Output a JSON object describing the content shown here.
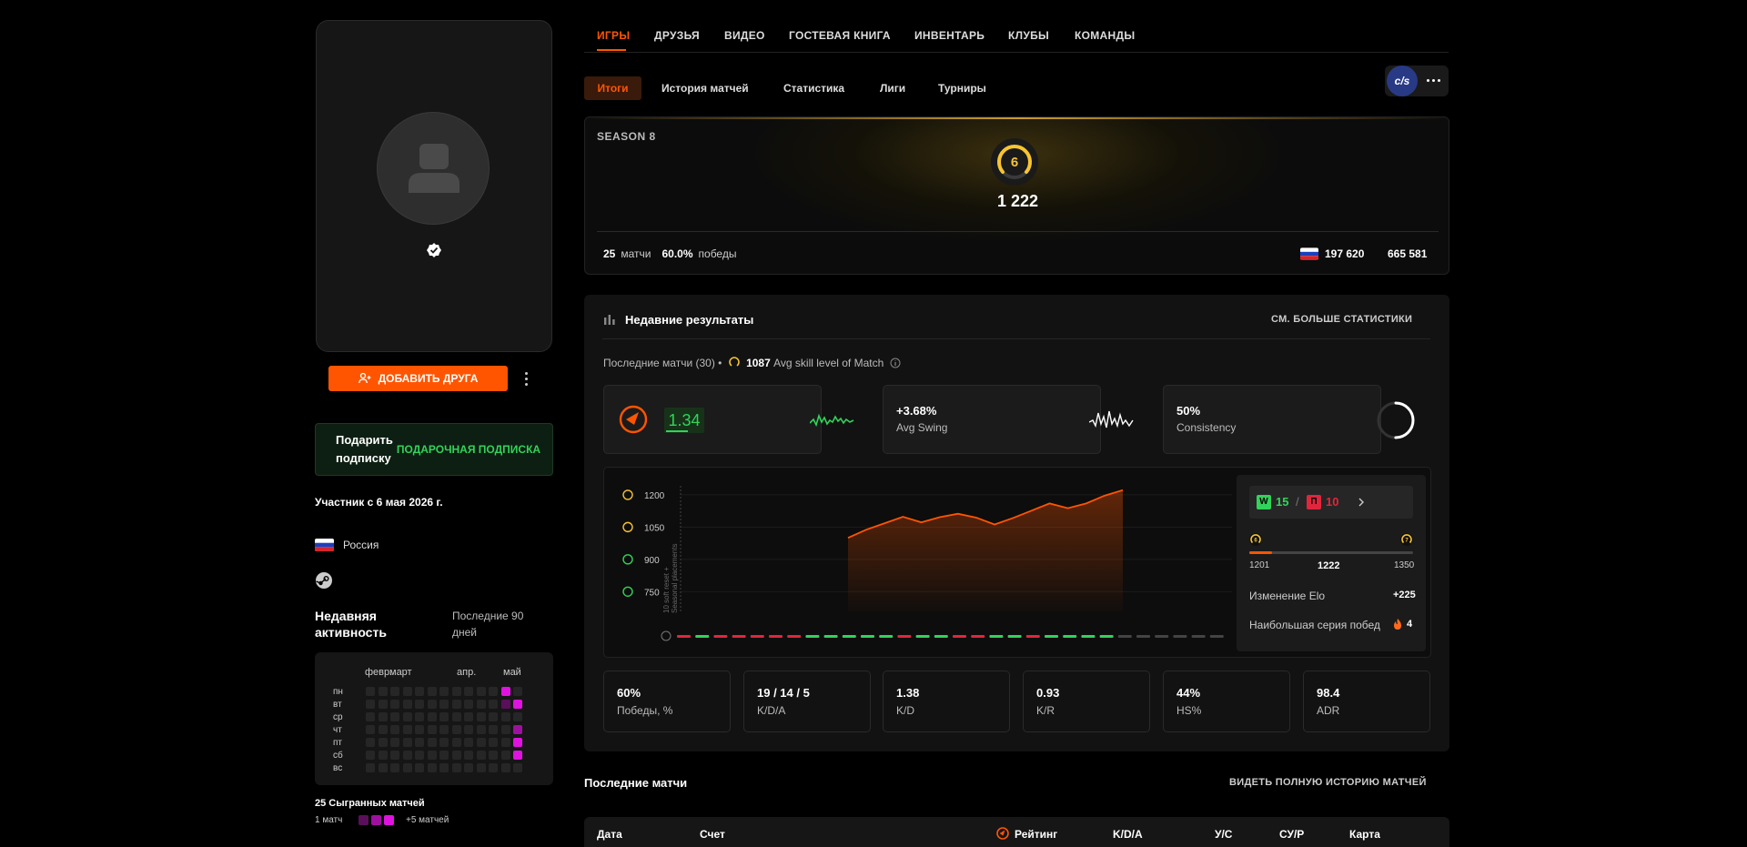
{
  "profile": {
    "add_friend_label": "ДОБАВИТЬ ДРУГА",
    "gift_text": "Подарить подписку",
    "gift_link": "ПОДАРОЧНАЯ ПОДПИСКА",
    "member_since": "Участник с 6 мая 2026 г.",
    "country": "Россия",
    "activity_title": "Недавняя активность",
    "activity_period": "Последние 90 дней",
    "months": [
      "февр.",
      "март",
      "апр.",
      "май"
    ],
    "days": [
      "пн",
      "вт",
      "ср",
      "чт",
      "пт",
      "сб",
      "вс"
    ],
    "games_played": "25 Сыгранных матчей",
    "legend_min": "1 матч",
    "legend_max": "+5 матчей",
    "colors": {
      "accent": "#ff5500",
      "gift_green": "#32d35a",
      "heat_high": "#e012e0",
      "heat_low": "#5a0f5a"
    }
  },
  "tabs": [
    {
      "label": "ИГРЫ"
    },
    {
      "label": "ДРУЗЬЯ"
    },
    {
      "label": "ВИДЕО"
    },
    {
      "label": "ГОСТЕВАЯ КНИГА"
    },
    {
      "label": "ИНВЕНТАРЬ"
    },
    {
      "label": "КЛУБЫ"
    },
    {
      "label": "КОМАНДЫ"
    }
  ],
  "subtabs": [
    {
      "label": "Итоги"
    },
    {
      "label": "История матчей"
    },
    {
      "label": "Статистика"
    },
    {
      "label": "Лиги"
    },
    {
      "label": "Турниры"
    }
  ],
  "game_logo": "c/s",
  "season": {
    "label": "SEASON 8",
    "level": "6",
    "elo": "1 222",
    "matches_value": "25",
    "matches_label": "матчи",
    "winrate_value": "60.0%",
    "winrate_label": "победы",
    "rank_country": "197 620",
    "rank_global": "665 581"
  },
  "recent": {
    "title": "Недавние результаты",
    "see_more": "СМ. БОЛЬШЕ СТАТИСТИКИ",
    "last_matches": "Последние матчи (30) •",
    "avg_skill_value": "1087",
    "avg_skill_label": "Avg skill level of Match",
    "rating_value": "1.34",
    "swing_value": "+3.68%",
    "swing_label": "Avg Swing",
    "consistency_value": "50%",
    "consistency_label": "Consistency",
    "consistency_fraction": 0.5
  },
  "chart_data": {
    "type": "area",
    "y_ticks": [
      "1200",
      "1050",
      "900",
      "750"
    ],
    "ylim": [
      675,
      1225
    ],
    "placement_label": "Seasonal placements",
    "placement_sublabel": "10 soft reset +",
    "elo": [
      1000,
      1038,
      1068,
      1098,
      1072,
      1096,
      1112,
      1094,
      1062,
      1092,
      1126,
      1160,
      1138,
      1160,
      1196,
      1222
    ],
    "results": [
      "L",
      "W",
      "L",
      "L",
      "L",
      "L",
      "L",
      "W",
      "W",
      "W",
      "W",
      "W",
      "L",
      "W",
      "W",
      "L",
      "L",
      "W",
      "W",
      "L",
      "W",
      "W",
      "W",
      "W",
      "N",
      "N",
      "N",
      "N",
      "N",
      "N"
    ],
    "colors": {
      "win": "#32d35a",
      "loss": "#e0263c",
      "none": "#444444",
      "line": "#ff5500"
    }
  },
  "side": {
    "wins": "15",
    "losses": "10",
    "win_letter": "W",
    "loss_letter": "П",
    "range_low": "1201",
    "range_current": "1222",
    "range_high": "1350",
    "range_fraction": 0.14,
    "level_current": "6",
    "level_next": "7",
    "elo_change_label": "Изменение Elo",
    "elo_change_value": "+225",
    "streak_label": "Наибольшая серия побед",
    "streak_value": "4"
  },
  "stats": [
    {
      "value": "60%",
      "label": "Победы, %"
    },
    {
      "value": "19 / 14 / 5",
      "label": "K/D/A"
    },
    {
      "value": "1.38",
      "label": "K/D"
    },
    {
      "value": "0.93",
      "label": "K/R"
    },
    {
      "value": "44%",
      "label": "HS%"
    },
    {
      "value": "98.4",
      "label": "ADR"
    }
  ],
  "matches": {
    "title": "Последние матчи",
    "full_history": "ВИДЕТЬ ПОЛНУЮ ИСТОРИЮ МАТЧЕЙ",
    "columns": [
      "Дата",
      "Счет",
      "Рейтинг",
      "K/D/A",
      "У/С",
      "СУ/Р",
      "Карта"
    ]
  }
}
